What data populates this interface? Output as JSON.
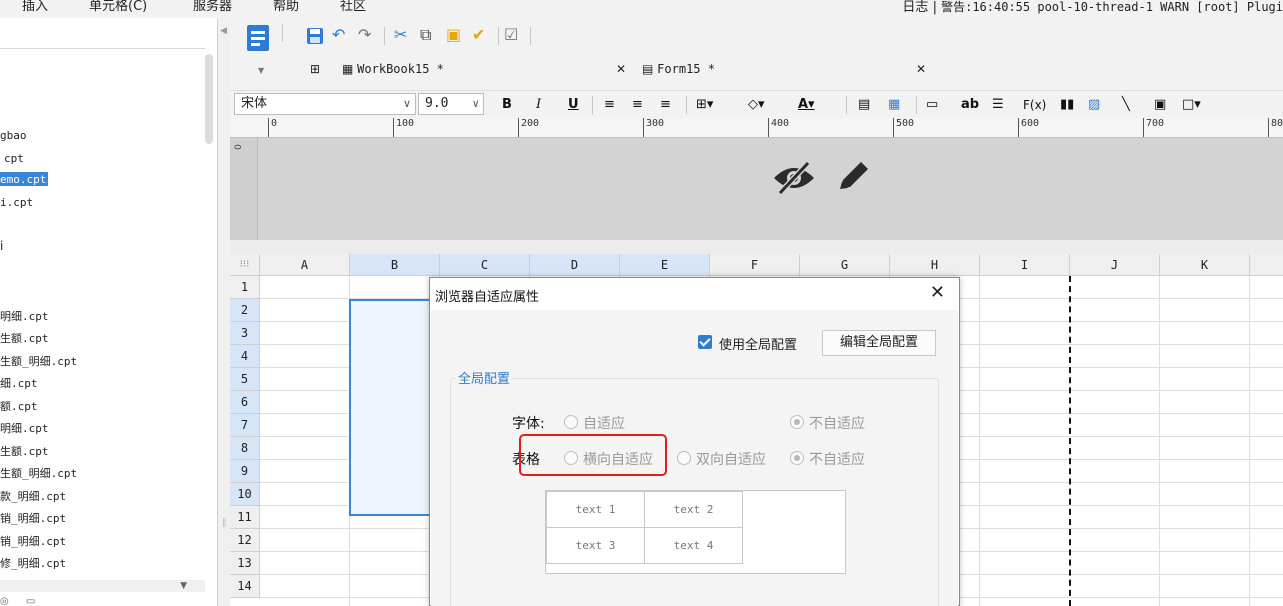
{
  "menubar": {
    "items": [
      "插入",
      "单元格(C)",
      "服务器",
      "帮助",
      "社区"
    ],
    "log_label": "日志",
    "log_sep": "|",
    "log_text": "警告:16:40:55 pool-10-thread-1 WARN [root] Plugi"
  },
  "tree": {
    "items": [
      {
        "text": "gbao",
        "selected": false
      },
      {
        "text": "cpt",
        "selected": false
      },
      {
        "text": "emo.cpt",
        "selected": true
      },
      {
        "text": "i.cpt",
        "selected": false
      },
      {
        "text": "i",
        "selected": false
      },
      {
        "text": "明细.cpt",
        "selected": false
      },
      {
        "text": "生额.cpt",
        "selected": false
      },
      {
        "text": "生额_明细.cpt",
        "selected": false
      },
      {
        "text": "细.cpt",
        "selected": false
      },
      {
        "text": "额.cpt",
        "selected": false
      },
      {
        "text": "明细.cpt",
        "selected": false
      },
      {
        "text": "生额.cpt",
        "selected": false
      },
      {
        "text": "生额_明细.cpt",
        "selected": false
      },
      {
        "text": "款_明细.cpt",
        "selected": false
      },
      {
        "text": "销_明细.cpt",
        "selected": false
      },
      {
        "text": "销_明细.cpt",
        "selected": false
      },
      {
        "text": "修_明细.cpt",
        "selected": false
      }
    ]
  },
  "tabs": [
    {
      "label": "WorkBook15 *"
    },
    {
      "label": "Form15 *"
    }
  ],
  "format": {
    "font": "宋体",
    "size": "9.0",
    "bold": "B",
    "italic": "I",
    "underline": "U",
    "text_glyph": "ab",
    "formula_glyph": "F(x)"
  },
  "ruler": {
    "ticks": [
      "0",
      "100",
      "200",
      "300",
      "400",
      "500",
      "600",
      "700",
      "80"
    ]
  },
  "grid": {
    "columns": [
      "A",
      "B",
      "C",
      "D",
      "E",
      "F",
      "G",
      "H",
      "I",
      "J",
      "K"
    ],
    "rows": [
      "1",
      "2",
      "3",
      "4",
      "5",
      "6",
      "7",
      "8",
      "9",
      "10",
      "11",
      "12",
      "13",
      "14"
    ]
  },
  "dialog": {
    "title": "浏览器自适应属性",
    "use_global_label": "使用全局配置",
    "use_global_checked": true,
    "edit_button": "编辑全局配置",
    "group_title": "全局配置",
    "font_label": "字体:",
    "font_options": [
      "自适应",
      "不自适应"
    ],
    "font_selected": "不自适应",
    "table_label": "表格",
    "table_options": [
      "横向自适应",
      "双向自适应",
      "不自适应"
    ],
    "table_selected": "不自适应",
    "preview_cells": [
      "text 1",
      "text 2",
      "text 3",
      "text 4"
    ]
  },
  "colors": {
    "accent": "#2f7bd3",
    "selection": "#3a86d6",
    "highlight_box": "#e01e1e"
  }
}
